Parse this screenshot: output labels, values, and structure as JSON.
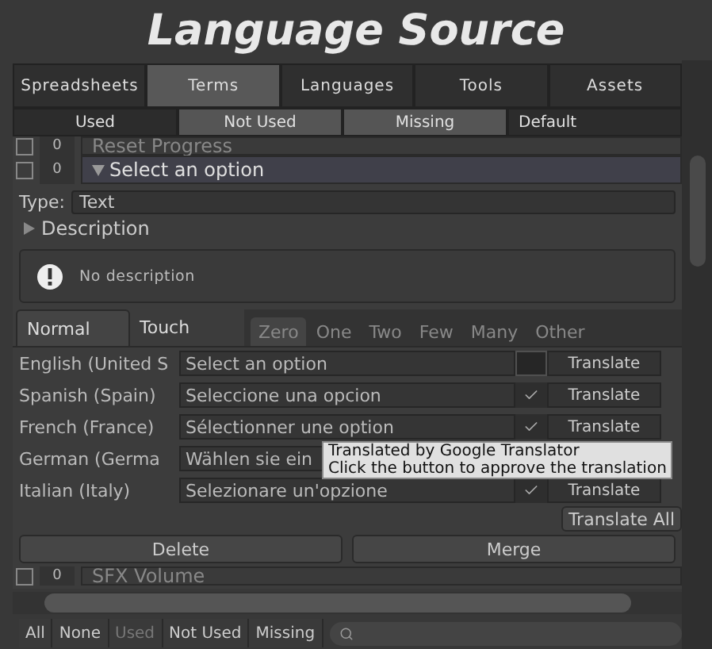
{
  "title": "Language Source",
  "main_tabs": [
    {
      "label": "Spreadsheets",
      "selected": false
    },
    {
      "label": "Terms",
      "selected": true
    },
    {
      "label": "Languages",
      "selected": false
    },
    {
      "label": "Tools",
      "selected": false
    },
    {
      "label": "Assets",
      "selected": false
    }
  ],
  "filter_tabs": [
    {
      "label": "Used",
      "selected": false,
      "kind": "toggle"
    },
    {
      "label": "Not Used",
      "selected": true,
      "kind": "toggle"
    },
    {
      "label": "Missing",
      "selected": true,
      "kind": "toggle"
    },
    {
      "label": "Default",
      "selected": false,
      "kind": "dropdown"
    }
  ],
  "terms_top": [
    {
      "count": "0",
      "name": "Reset Progress",
      "checked": false,
      "expanded": false
    }
  ],
  "term": {
    "count": "0",
    "name": "Select an option",
    "checked": false,
    "expanded": true,
    "type_label": "Type:",
    "type_value": "Text",
    "description": {
      "label": "Description",
      "expanded": false,
      "text": "No description"
    },
    "mode_tabs": [
      {
        "label": "Normal",
        "selected": true
      },
      {
        "label": "Touch",
        "selected": false
      }
    ],
    "plural_tabs": [
      {
        "label": "Zero",
        "selected": true
      },
      {
        "label": "One",
        "selected": false
      },
      {
        "label": "Two",
        "selected": false
      },
      {
        "label": "Few",
        "selected": false
      },
      {
        "label": "Many",
        "selected": false
      },
      {
        "label": "Other",
        "selected": false
      }
    ],
    "languages": [
      {
        "name": "English (United S",
        "value": "Select an option",
        "checked": false,
        "translate": "Translate"
      },
      {
        "name": "Spanish (Spain)",
        "value": "Seleccione una opcion",
        "checked": true,
        "translate": "Translate"
      },
      {
        "name": "French (France)",
        "value": "Sélectionner une option",
        "checked": true,
        "translate": "Translate"
      },
      {
        "name": "German (Germa",
        "value": "Wählen sie ein"
      },
      {
        "name": "Italian (Italy)",
        "value": "Selezionare un'opzione",
        "checked": true,
        "translate": "Translate"
      }
    ],
    "translate_all": "Translate All",
    "buttons": [
      "Delete",
      "Merge"
    ]
  },
  "terms_bottom": [
    {
      "count": "0",
      "name": "SFX Volume",
      "checked": false,
      "expanded": false
    }
  ],
  "tooltip": [
    "Translated by Google Translator",
    "Click the button to approve the translation"
  ],
  "bottom_filters": [
    {
      "label": "All",
      "disabled": false
    },
    {
      "label": "None",
      "disabled": false
    },
    {
      "label": "Used",
      "disabled": true
    },
    {
      "label": "Not Used",
      "disabled": false
    },
    {
      "label": "Missing",
      "disabled": false
    }
  ]
}
